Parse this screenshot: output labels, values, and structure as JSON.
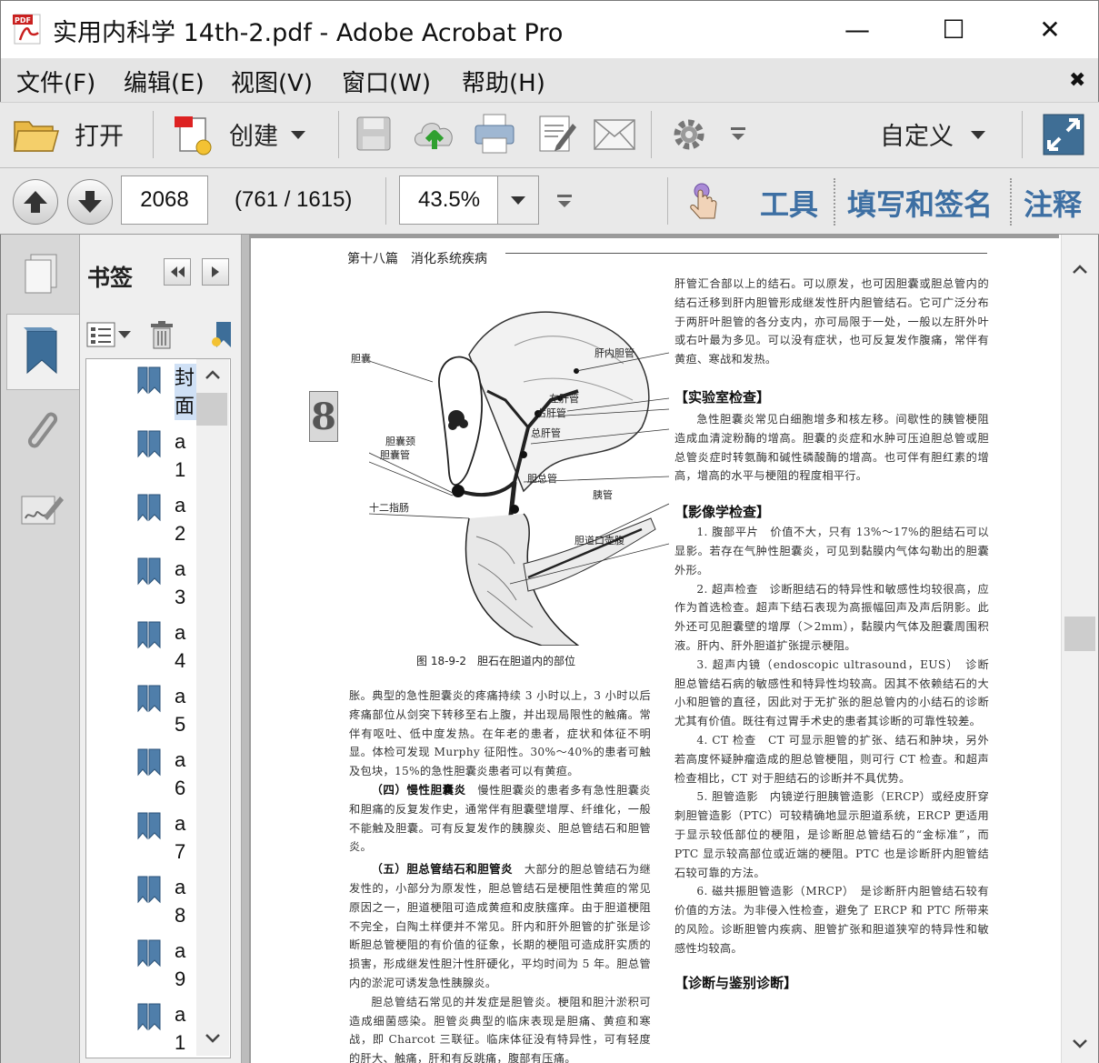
{
  "window": {
    "title": "实用内科学 14th-2.pdf - Adobe Acrobat Pro",
    "minimize": "—",
    "maximize": "☐",
    "close": "✕"
  },
  "menu": {
    "items": [
      "文件(F)",
      "编辑(E)",
      "视图(V)",
      "窗口(W)",
      "帮助(H)"
    ],
    "close": "✖"
  },
  "toolbar": {
    "open_label": "打开",
    "create_label": "创建",
    "customize_label": "自定义"
  },
  "nav": {
    "page_number": "2068",
    "page_count": "(761 / 1615)",
    "zoom": "43.5%",
    "tools_label": "工具",
    "fill_sign_label": "填写和签名",
    "comment_label": "注释"
  },
  "bookmarks": {
    "title": "书签",
    "items": [
      {
        "lines": [
          "封",
          "面"
        ]
      },
      {
        "lines": [
          "a",
          "1"
        ]
      },
      {
        "lines": [
          "a",
          "2"
        ]
      },
      {
        "lines": [
          "a",
          "3"
        ]
      },
      {
        "lines": [
          "a",
          "4"
        ]
      },
      {
        "lines": [
          "a",
          "5"
        ]
      },
      {
        "lines": [
          "a",
          "6"
        ]
      },
      {
        "lines": [
          "a",
          "7"
        ]
      },
      {
        "lines": [
          "a",
          "8"
        ]
      },
      {
        "lines": [
          "a",
          "9"
        ]
      },
      {
        "lines": [
          "a",
          "1"
        ]
      }
    ]
  },
  "document": {
    "header": "第十八篇　消化系统疾病",
    "chapter_tab": "8",
    "figure": {
      "caption": "图 18-9-2　胆石在胆道内的部位",
      "labels": {
        "gallbladder": "胆囊",
        "intrahepatic_duct": "肝内胆管",
        "left_hepatic_duct": "左肝管",
        "right_hepatic_duct": "右肝管",
        "common_hepatic_duct": "总肝管",
        "gallbladder_neck": "胆囊颈",
        "cystic_duct": "胆囊管",
        "common_bile_duct": "胆总管",
        "duodenum": "十二指肠",
        "pancreatic_duct": "胰管",
        "ampulla": "胆道口壶腹"
      }
    },
    "left_col": {
      "p1": "胀。典型的急性胆囊炎的疼痛持续 3 小时以上，3 小时以后疼痛部位从剑突下转移至右上腹，并出现局限性的触痛。常伴有呕吐、低中度发热。在年老的患者，症状和体征不明显。体检可发现 Murphy 征阳性。30%～40%的患者可触及包块，15%的急性胆囊炎患者可以有黄疸。",
      "p2_head": "（四）慢性胆囊炎",
      "p2": "慢性胆囊炎的患者多有急性胆囊炎和胆痛的反复发作史，通常伴有胆囊壁增厚、纤维化，一般不能触及胆囊。可有反复发作的胰腺炎、胆总管结石和胆管炎。",
      "p3_head": "（五）胆总管结石和胆管炎",
      "p3": "大部分的胆总管结石为继发性的，小部分为原发性，胆总管结石是梗阻性黄疸的常见原因之一，胆道梗阻可造成黄疸和皮肤瘙痒。由于胆道梗阻不完全，白陶土样便并不常见。肝内和肝外胆管的扩张是诊断胆总管梗阻的有价值的征象，长期的梗阻可造成肝实质的损害，形成继发性胆汁性肝硬化，平均时间为 5 年。胆总管内的淤泥可诱发急性胰腺炎。",
      "p4": "胆总管结石常见的并发症是胆管炎。梗阻和胆汁淤积可造成细菌感染。胆管炎典型的临床表现是胆痛、黄疸和寒战，即 Charcot 三联征。临床体征没有特异性，可有轻度的肝大、触痛，肝和有反跳痛，腹部有压痛。"
    },
    "right_col": {
      "p1": "肝管汇合部以上的结石。可以原发，也可因胆囊或胆总管内的结石迁移到肝内胆管形成继发性肝内胆管结石。它可广泛分布于两肝叶胆管的各分支内，亦可局限于一处，一般以左肝外叶或右叶最为多见。可以没有症状，也可反复发作腹痛，常伴有黄疸、寒战和发热。",
      "lab_head": "【实验室检查】",
      "lab": "急性胆囊炎常见白细胞增多和核左移。间歇性的胰管梗阻造成血清淀粉酶的增高。胆囊的炎症和水肿可压迫胆总管或胆总管炎症时转氨酶和碱性磷酸酶的增高。也可伴有胆红素的增高，增高的水平与梗阻的程度相平行。",
      "img_head": "【影像学检查】",
      "i1": "1. 腹部平片　价值不大，只有 13%～17%的胆结石可以显影。若存在气肿性胆囊炎，可见到黏膜内气体勾勒出的胆囊外形。",
      "i2": "2. 超声检查　诊断胆结石的特异性和敏感性均较很高，应作为首选检查。超声下结石表现为高振幅回声及声后阴影。此外还可见胆囊壁的增厚（＞2mm），黏膜内气体及胆囊周围积液。肝内、肝外胆道扩张提示梗阻。",
      "i3": "3. 超声内镜（endoscopic ultrasound，EUS）　诊断胆总管结石病的敏感性和特异性均较高。因其不依赖结石的大小和胆管的直径，因此对于无扩张的胆总管内的小结石的诊断尤其有价值。既往有过胃手术史的患者其诊断的可靠性较差。",
      "i4": "4. CT 检查　CT 可显示胆管的扩张、结石和肿块，另外若高度怀疑肿瘤造成的胆总管梗阻，则可行 CT 检查。和超声检查相比，CT 对于胆结石的诊断并不具优势。",
      "i5": "5. 胆管造影　内镜逆行胆胰管造影（ERCP）或经皮肝穿刺胆管造影（PTC）可较精确地显示胆道系统，ERCP 更适用于显示较低部位的梗阻，是诊断胆总管结石的“金标准”，而 PTC 显示较高部位或近端的梗阻。PTC 也是诊断肝内胆管结石较可靠的方法。",
      "i6": "6. 磁共振胆管造影（MRCP）　是诊断肝内胆管结石较有价值的方法。为非侵入性检查，避免了 ERCP 和 PTC 所带来的风险。诊断胆管内疾病、胆管扩张和胆道狭窄的特异性和敏感性均较高。",
      "dx_head": "【诊断与鉴别诊断】"
    }
  }
}
